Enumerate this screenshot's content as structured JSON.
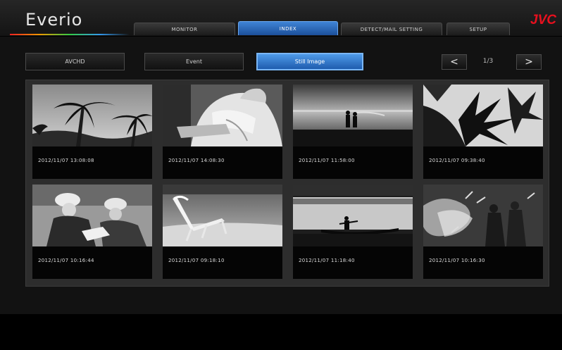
{
  "app": {
    "title": "Everio",
    "brand": "JVC"
  },
  "nav": {
    "tabs": [
      {
        "label": "MONITOR",
        "active": false
      },
      {
        "label": "INDEX",
        "active": true
      },
      {
        "label": "DETECT/MAIL SETTING",
        "active": false
      },
      {
        "label": "SETUP",
        "active": false
      }
    ]
  },
  "filters": [
    {
      "label": "AVCHD",
      "active": false
    },
    {
      "label": "Event",
      "active": false
    },
    {
      "label": "Still Image",
      "active": true
    }
  ],
  "pager": {
    "prev_icon": "<",
    "next_icon": ">",
    "page": "1/3"
  },
  "thumbnails": [
    {
      "label": "2012/11/07 13:08:08",
      "scene": "palm-trees"
    },
    {
      "label": "2012/11/07 14:08:30",
      "scene": "person-reading"
    },
    {
      "label": "2012/11/07 11:58:00",
      "scene": "beach-couple"
    },
    {
      "label": "2012/11/07 09:38:40",
      "scene": "leaves"
    },
    {
      "label": "2012/11/07 10:16:44",
      "scene": "cyclists"
    },
    {
      "label": "2012/11/07 09:18:10",
      "scene": "beach-chair"
    },
    {
      "label": "2012/11/07 11:18:40",
      "scene": "canoe"
    },
    {
      "label": "2012/11/07 10:16:30",
      "scene": "water-splash"
    }
  ]
}
